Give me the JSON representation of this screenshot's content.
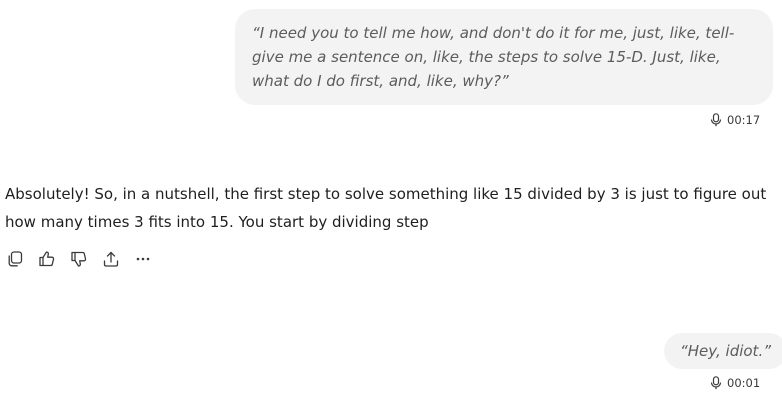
{
  "conversation": {
    "messages": [
      {
        "role": "user",
        "type": "voice",
        "transcript": "“I need you to tell me how, and don't do it for me, just, like, tell- give me a sentence on, like, the steps to solve 15-D. Just, like, what do I do first, and, like, why?”",
        "duration": "00:17"
      },
      {
        "role": "assistant",
        "text": "Absolutely! So, in a nutshell, the first step to solve something like 15 divided by 3 is just to figure out how many times 3 fits into 15. You start by dividing step",
        "actions": [
          "copy-icon",
          "thumbs-up-icon",
          "thumbs-down-icon",
          "share-icon",
          "more-icon"
        ]
      },
      {
        "role": "user",
        "type": "voice",
        "transcript": "“Hey, idiot.”",
        "duration": "00:01"
      }
    ]
  }
}
